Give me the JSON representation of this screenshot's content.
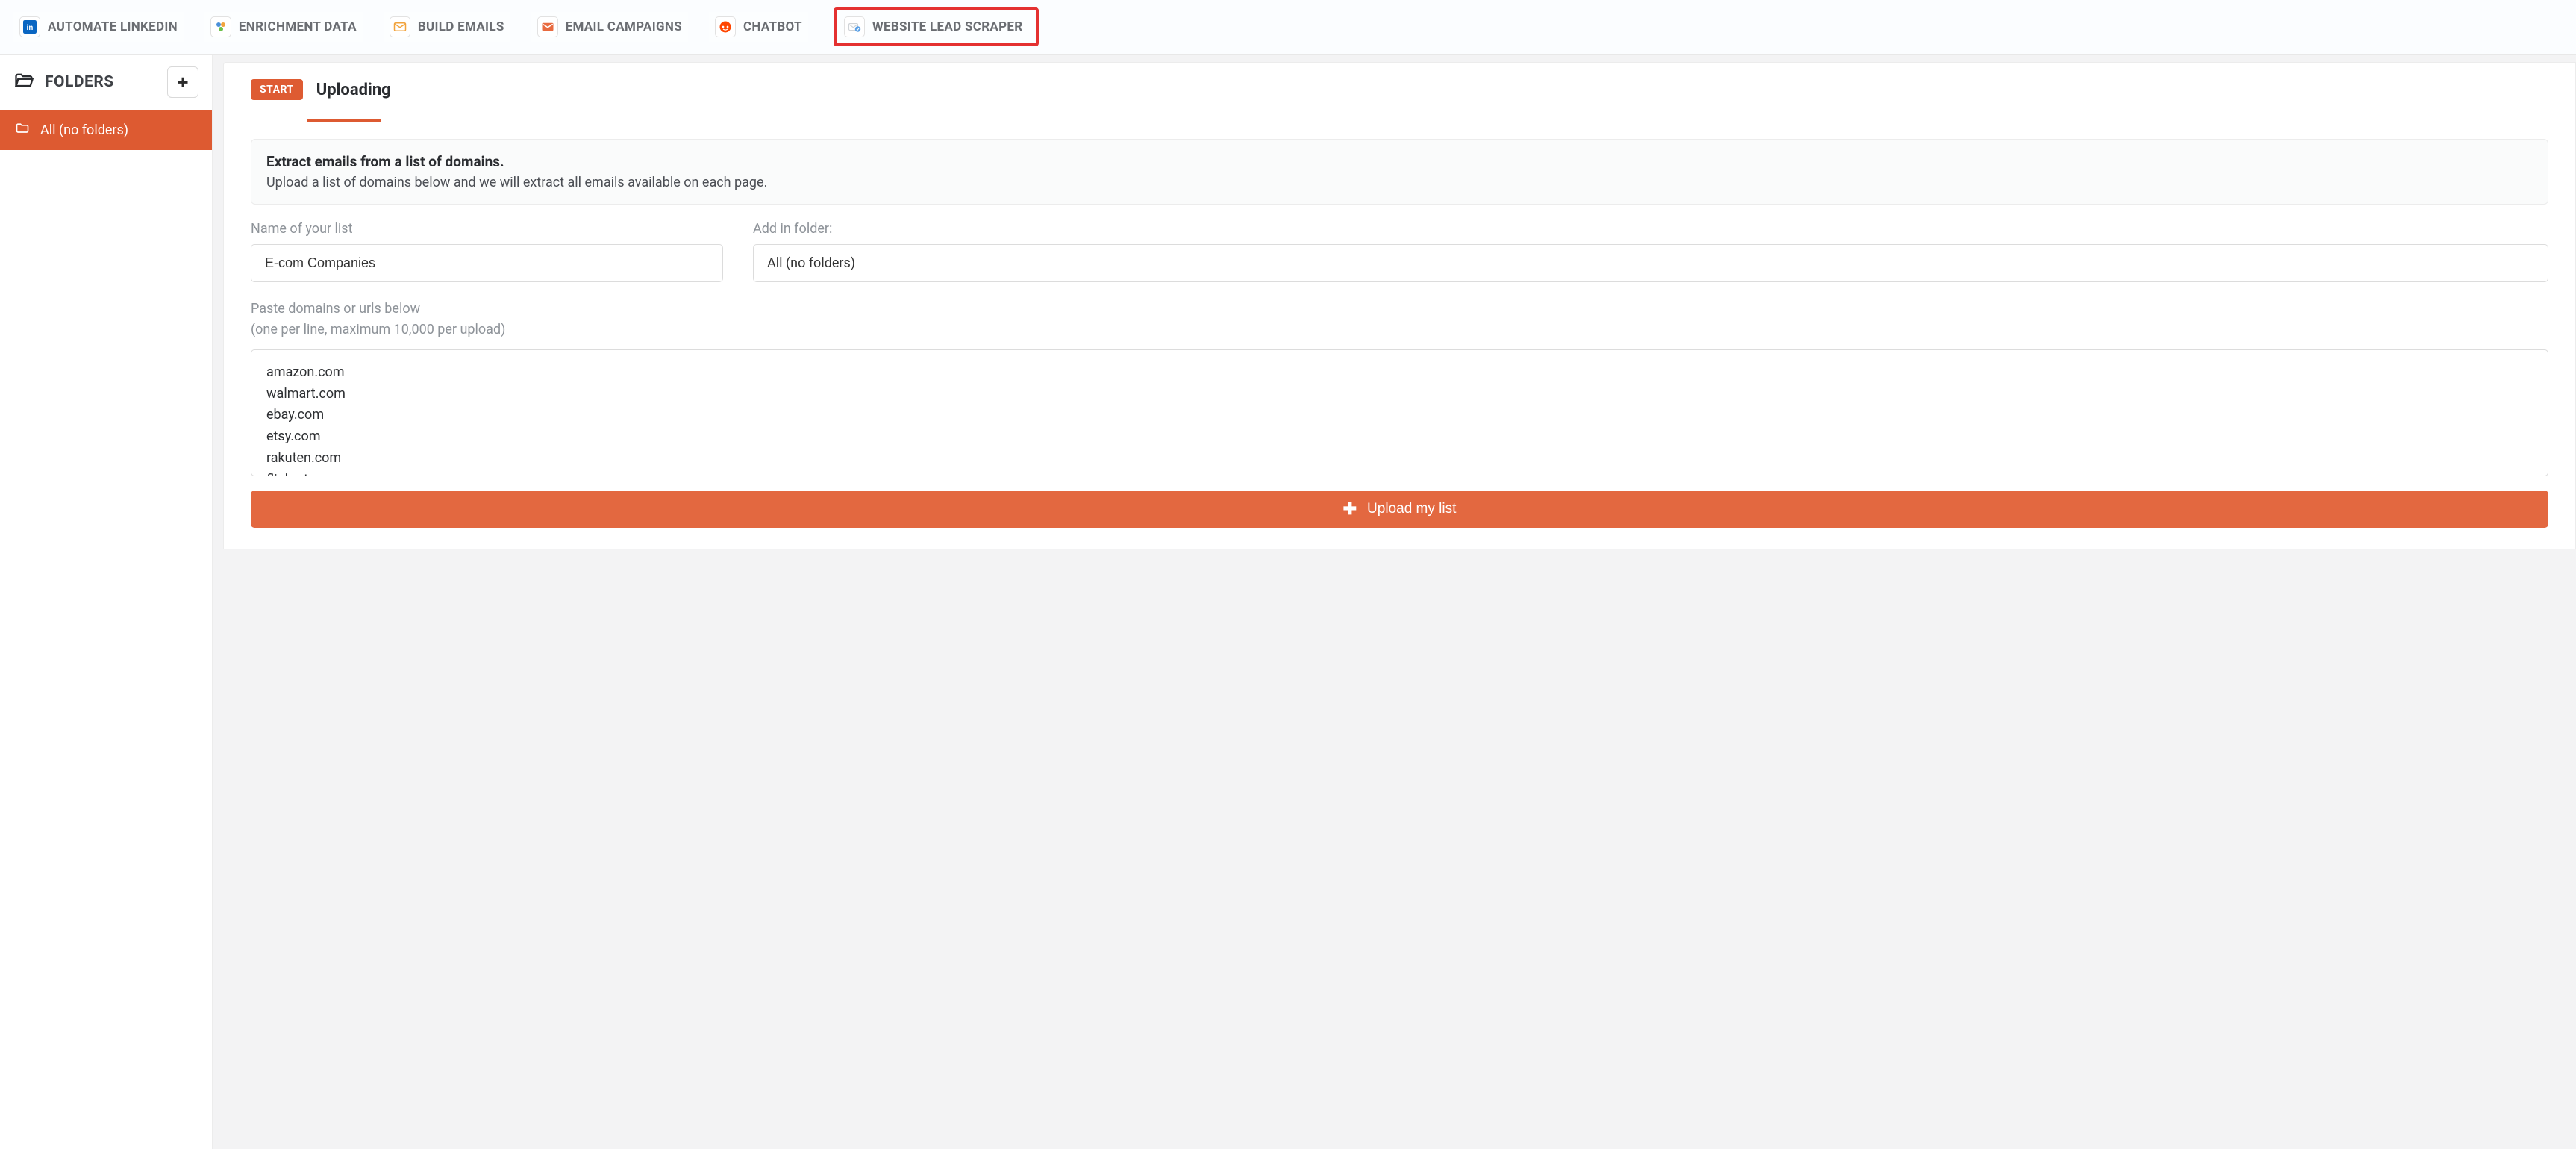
{
  "topnav": {
    "items": [
      {
        "label": "AUTOMATE LINKEDIN",
        "icon": "linkedin-icon",
        "icon_bg": "#0a66c2",
        "icon_char": "in"
      },
      {
        "label": "ENRICHMENT DATA",
        "icon": "enrichment-icon",
        "icon_bg": "#ffffff",
        "icon_char": "✳"
      },
      {
        "label": "BUILD EMAILS",
        "icon": "build-emails-icon",
        "icon_bg": "#ffffff",
        "icon_char": "✉"
      },
      {
        "label": "EMAIL CAMPAIGNS",
        "icon": "email-campaigns-icon",
        "icon_bg": "#ffffff",
        "icon_char": "📧"
      },
      {
        "label": "CHATBOT",
        "icon": "chatbot-icon",
        "icon_bg": "#ffffff",
        "icon_char": "💬"
      },
      {
        "label": "WEBSITE LEAD SCRAPER",
        "icon": "website-scraper-icon",
        "icon_bg": "#ffffff",
        "icon_char": "✉",
        "highlighted": true
      }
    ]
  },
  "sidebar": {
    "folders_title": "FOLDERS",
    "add_button_label": "+",
    "items": [
      {
        "label": "All (no folders)"
      }
    ]
  },
  "main": {
    "start_badge": "START",
    "tab_label": "Uploading",
    "info_title": "Extract emails from a list of domains.",
    "info_subtitle": "Upload a list of domains below and we will extract all emails available on each page.",
    "list_name_label": "Name of your list",
    "list_name_value": "E-com Companies",
    "folder_label": "Add in folder:",
    "folder_value": "All (no folders)",
    "paste_label_line1": "Paste domains or urls below",
    "paste_label_line2": "(one per line, maximum 10,000 per upload)",
    "domains_value": "amazon.com\nwalmart.com\nebay.com\netsy.com\nrakuten.com\nflipkart.com",
    "upload_button_label": "Upload my list"
  },
  "colors": {
    "accent": "#dd5a31",
    "highlight_border": "#e43131"
  }
}
